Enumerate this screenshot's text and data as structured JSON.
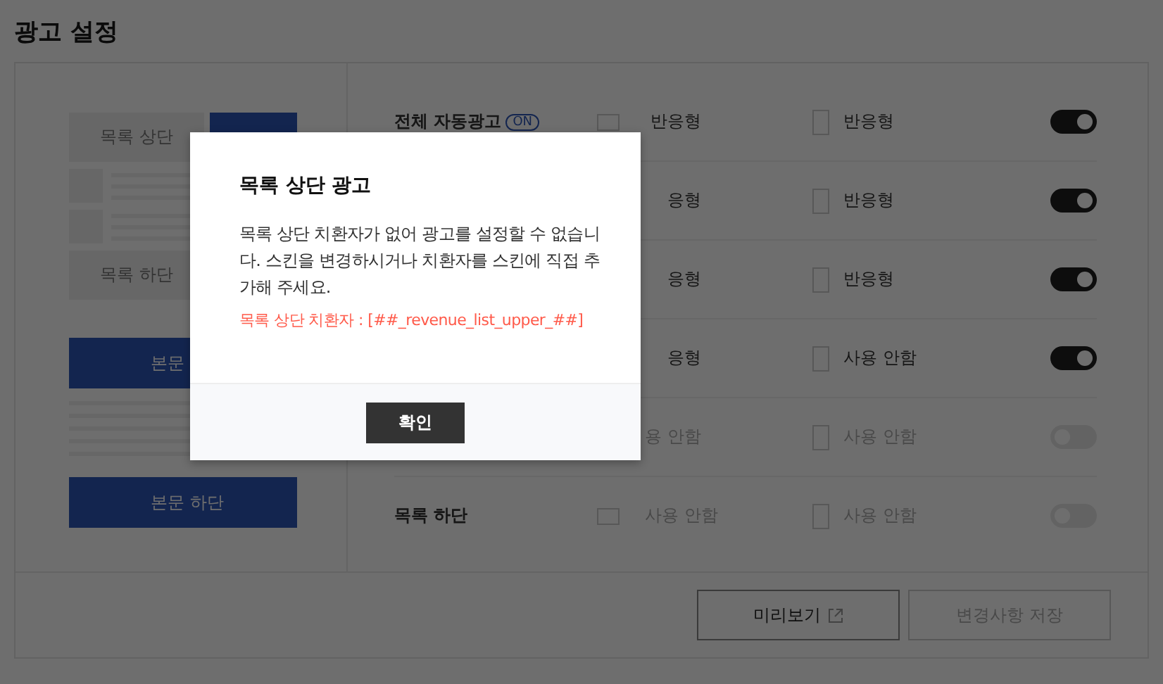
{
  "page_title": "광고 설정",
  "preview": {
    "top_block": "목록 상단",
    "bottom_block": "목록 하단",
    "body_top_button": "본문",
    "body_bottom_button": "본문 하단"
  },
  "rows": [
    {
      "label": "전체 자동광고",
      "badge": "ON",
      "pc": "반응형",
      "mobile": "반응형",
      "on": true
    },
    {
      "pc": "응형",
      "mobile": "반응형",
      "on": true
    },
    {
      "pc": "응형",
      "mobile": "반응형",
      "on": true
    },
    {
      "pc": "응형",
      "mobile": "사용 안함",
      "on": true
    },
    {
      "pc": "용 안함",
      "mobile": "사용 안함",
      "on": false
    },
    {
      "label": "목록 하단",
      "pc": "사용 안함",
      "mobile": "사용 안함",
      "on": false
    }
  ],
  "buttons": [
    {
      "label": "미리보기",
      "kind": "external"
    },
    {
      "label": "변경사항 저장",
      "kind": "plain"
    }
  ],
  "dialog": {
    "title": "목록 상단 광고",
    "message": "목록 상단 치환자가 없어 광고를 설정할 수 없습니다. 스킨을 변경하시거나 치환자를 스킨에 직접 추가해 주세요.",
    "note": "목록 상단 치환자 : [##_revenue_list_upper_##]",
    "button": "확인"
  }
}
